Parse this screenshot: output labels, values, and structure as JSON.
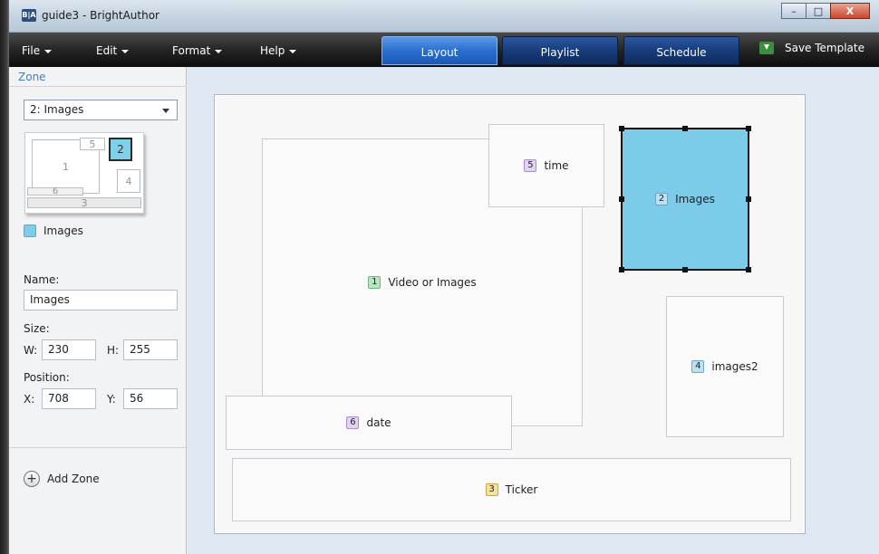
{
  "window": {
    "app_icon_text": "B|A",
    "title": "guide3 - BrightAuthor",
    "controls": {
      "minimize": "–",
      "maximize": "□",
      "close": "X"
    }
  },
  "menubar": {
    "menus": [
      "File",
      "Edit",
      "Format",
      "Help"
    ],
    "tabs": [
      {
        "label": "Layout",
        "active": true
      },
      {
        "label": "Playlist",
        "active": false
      },
      {
        "label": "Schedule",
        "active": false
      }
    ],
    "save_template": "Save Template"
  },
  "sidebar": {
    "header": "Zone",
    "selected_zone": "2: Images",
    "mini_labels": {
      "z1": "1",
      "z2": "2",
      "z3": "3",
      "z4": "4",
      "z5": "5",
      "z6": "6"
    },
    "legend_label": "Images",
    "name_label": "Name:",
    "name_value": "Images",
    "size_label": "Size:",
    "w_label": "W:",
    "w_value": "230",
    "h_label": "H:",
    "h_value": "255",
    "position_label": "Position:",
    "x_label": "X:",
    "x_value": "708",
    "y_label": "Y:",
    "y_value": "56",
    "add_zone": "Add Zone"
  },
  "zones": [
    {
      "num": "1",
      "label": "Video or Images",
      "color": "#b8e6c2"
    },
    {
      "num": "5",
      "label": "time",
      "color": "#e2d3f2"
    },
    {
      "num": "2",
      "label": "Images",
      "color": "#7ccbe8",
      "selected": true
    },
    {
      "num": "4",
      "label": "images2",
      "color": "#bde0f2"
    },
    {
      "num": "6",
      "label": "date",
      "color": "#e2d3f2"
    },
    {
      "num": "3",
      "label": "Ticker",
      "color": "#f5e19a"
    }
  ]
}
